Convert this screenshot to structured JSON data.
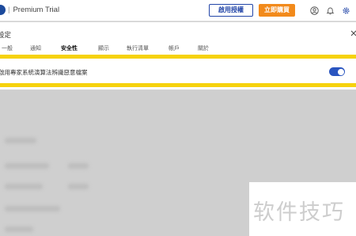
{
  "app": {
    "title_prefix": "|",
    "title": "Premium Trial"
  },
  "toolbar": {
    "activate_label": "啟用授權",
    "buy_label": "立即購買"
  },
  "icons": {
    "user": "user-icon",
    "notification": "bell-icon",
    "settings": "gear-icon",
    "close": "close-icon"
  },
  "panel": {
    "title": "設定",
    "tabs": [
      {
        "label": "一般"
      },
      {
        "label": "通知"
      },
      {
        "label": "安全性"
      },
      {
        "label": "顯示"
      },
      {
        "label": "執行清單"
      },
      {
        "label": "帳戶"
      },
      {
        "label": "關於"
      }
    ],
    "active_tab": "安全性",
    "setting_row": {
      "label": "啟用專家系統演算法辨識惡意檔案",
      "toggle_on": true
    }
  },
  "watermark": {
    "text": "软件技巧"
  },
  "colors": {
    "accent": "#2346a8",
    "buy": "#f28a1b",
    "highlight": "#f6d20d",
    "toggle_on": "#2a55c0"
  }
}
